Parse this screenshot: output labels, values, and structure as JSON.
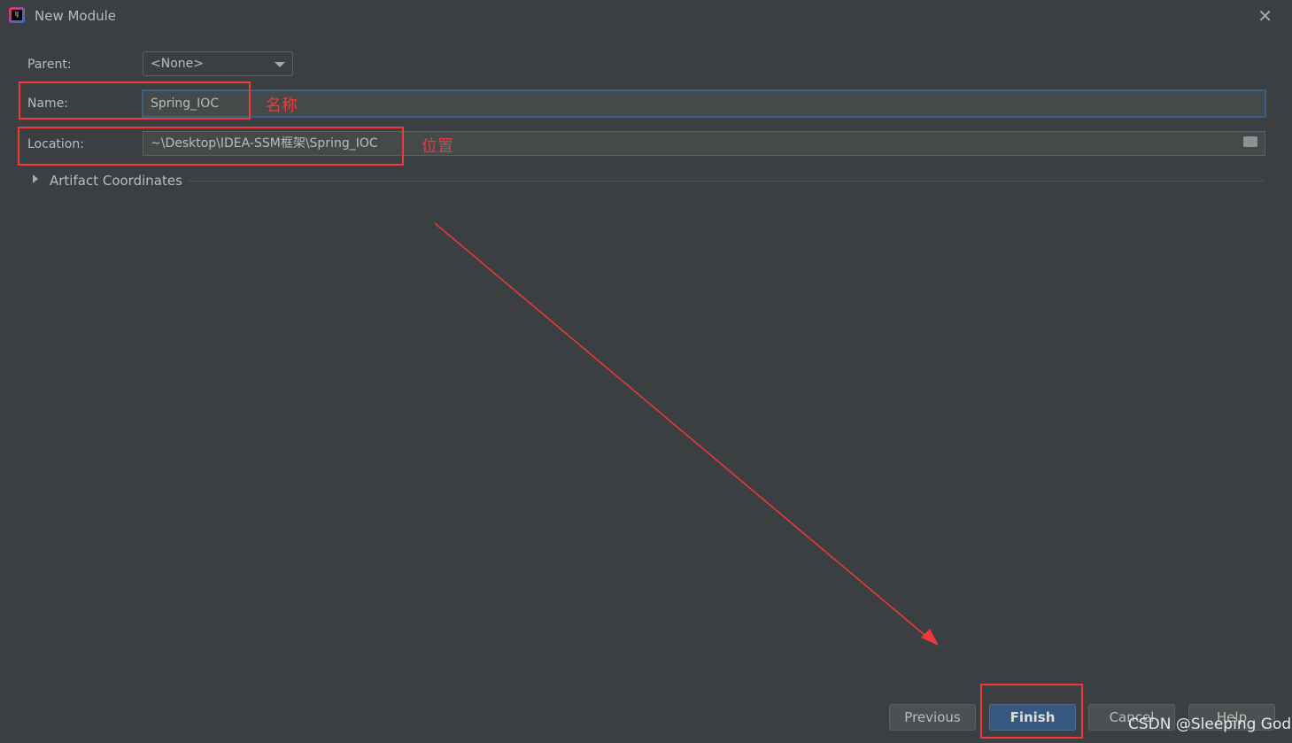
{
  "window": {
    "title": "New Module",
    "icon": "intellij-idea-icon"
  },
  "form": {
    "parent_label": "Parent:",
    "parent_value": "<None>",
    "name_label": "Name:",
    "name_value": "Spring_IOC",
    "location_label": "Location:",
    "location_value": "~\\Desktop\\IDEA-SSM框架\\Spring_IOC",
    "artifact_label": "Artifact Coordinates"
  },
  "annotations": {
    "name_note": "名称",
    "location_note": "位置",
    "color": "#f03a3a"
  },
  "buttons": {
    "previous": "Previous",
    "finish": "Finish",
    "cancel": "Cancel",
    "help": "Help"
  },
  "watermark": "CSDN @Sleeping God"
}
